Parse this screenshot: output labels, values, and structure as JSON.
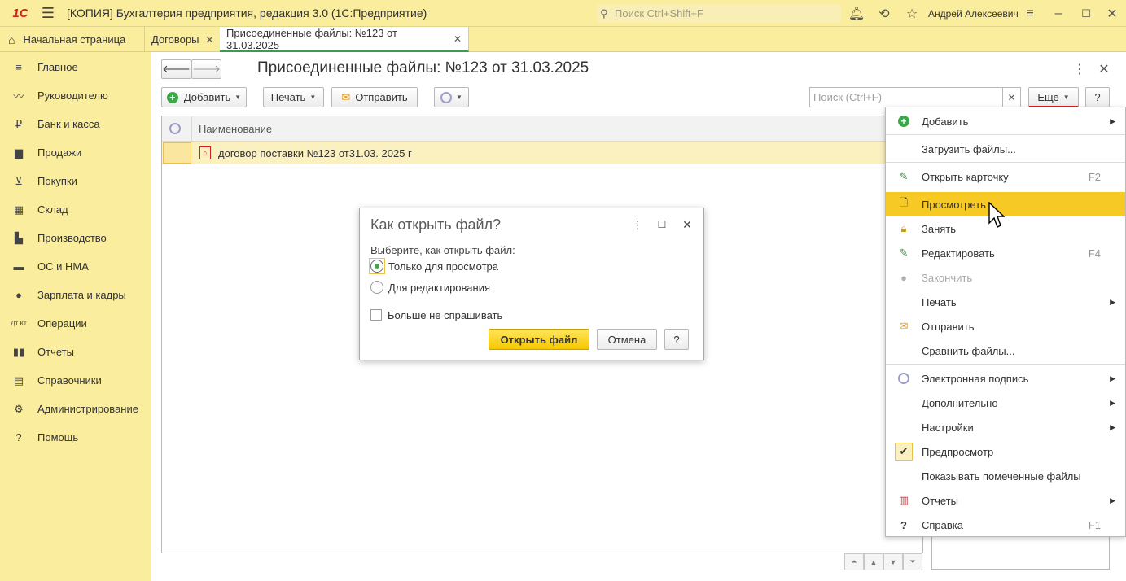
{
  "titlebar": {
    "logo": "1С",
    "title": "[КОПИЯ] Бухгалтерия предприятия, редакция 3.0  (1С:Предприятие)",
    "search_placeholder": "Поиск Ctrl+Shift+F",
    "user": "Андрей Алексеевич"
  },
  "tabs": [
    {
      "label": "Начальная страница"
    },
    {
      "label": "Договоры"
    },
    {
      "label": "Присоединенные файлы: №123 от 31.03.2025"
    }
  ],
  "sidebar": {
    "items": [
      {
        "label": "Главное",
        "icon": "≡"
      },
      {
        "label": "Руководителю",
        "icon": "⤳"
      },
      {
        "label": "Банк и касса",
        "icon": "₽"
      },
      {
        "label": "Продажи",
        "icon": "▦"
      },
      {
        "label": "Покупки",
        "icon": "🛒"
      },
      {
        "label": "Склад",
        "icon": "▦"
      },
      {
        "label": "Производство",
        "icon": "▞"
      },
      {
        "label": "ОС и НМА",
        "icon": "🚚"
      },
      {
        "label": "Зарплата и кадры",
        "icon": "👤"
      },
      {
        "label": "Операции",
        "icon": "ДтКт"
      },
      {
        "label": "Отчеты",
        "icon": "▮"
      },
      {
        "label": "Справочники",
        "icon": "▤"
      },
      {
        "label": "Администрирование",
        "icon": "⚙"
      },
      {
        "label": "Помощь",
        "icon": "?"
      }
    ]
  },
  "page": {
    "title": "Присоединенные файлы: №123 от 31.03.2025",
    "toolbar": {
      "add": "Добавить",
      "print": "Печать",
      "send": "Отправить",
      "more": "Еще",
      "help": "?",
      "search_placeholder": "Поиск (Ctrl+F)"
    },
    "table": {
      "column_name": "Наименование",
      "rows": [
        {
          "name": "договор поставки №123 от31.03. 2025 г"
        }
      ]
    }
  },
  "dialog": {
    "title": "Как открыть файл?",
    "prompt": "Выберите, как открыть файл:",
    "option_view": "Только для просмотра",
    "option_edit": "Для редактирования",
    "dont_ask": "Больше не спрашивать",
    "open_button": "Открыть файл",
    "cancel_button": "Отмена",
    "help_button": "?"
  },
  "menu": {
    "items": [
      {
        "label": "Добавить",
        "shortcut": "",
        "submenu": true
      },
      {
        "label": "Загрузить файлы...",
        "shortcut": "",
        "submenu": false
      },
      {
        "label": "Открыть карточку",
        "shortcut": "F2",
        "submenu": false
      },
      {
        "label": "Просмотреть",
        "shortcut": "",
        "submenu": false,
        "highlighted": true
      },
      {
        "label": "Занять",
        "shortcut": "",
        "submenu": false
      },
      {
        "label": "Редактировать",
        "shortcut": "F4",
        "submenu": false
      },
      {
        "label": "Закончить",
        "shortcut": "",
        "submenu": false,
        "disabled": true
      },
      {
        "label": "Печать",
        "shortcut": "",
        "submenu": true
      },
      {
        "label": "Отправить",
        "shortcut": "",
        "submenu": false
      },
      {
        "label": "Сравнить файлы...",
        "shortcut": "",
        "submenu": false
      },
      {
        "label": "Электронная подпись",
        "shortcut": "",
        "submenu": true
      },
      {
        "label": "Дополнительно",
        "shortcut": "",
        "submenu": true
      },
      {
        "label": "Настройки",
        "shortcut": "",
        "submenu": true
      },
      {
        "label": "Предпросмотр",
        "shortcut": "",
        "submenu": false,
        "checked": true
      },
      {
        "label": "Показывать помеченные файлы",
        "shortcut": "",
        "submenu": false
      },
      {
        "label": "Отчеты",
        "shortcut": "",
        "submenu": true
      },
      {
        "label": "Справка",
        "shortcut": "F1",
        "submenu": false
      }
    ]
  },
  "colors": {
    "panel_bg": "#fbed9e",
    "accent_yellow": "#f7c925",
    "green": "#3aa848",
    "red": "#d42020"
  }
}
